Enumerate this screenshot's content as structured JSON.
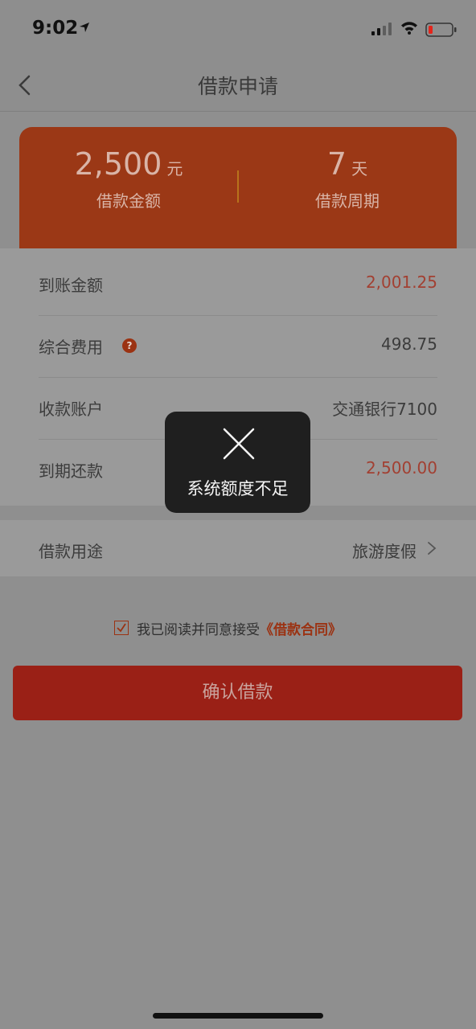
{
  "status_bar": {
    "time": "9:02"
  },
  "nav": {
    "title": "借款申请"
  },
  "summary": {
    "amount": "2,500",
    "amount_unit": "元",
    "amount_label": "借款金额",
    "period": "7",
    "period_unit": "天",
    "period_label": "借款周期"
  },
  "details": {
    "rows": [
      {
        "label": "到账金额",
        "value": "2,001.25"
      },
      {
        "label": "综合费用",
        "value": "498.75",
        "help": "?"
      },
      {
        "label": "收款账户",
        "value": "交通银行7100"
      },
      {
        "label": "到期还款",
        "value": "2,500.00"
      }
    ]
  },
  "purpose": {
    "label": "借款用途",
    "value": "旅游度假"
  },
  "agreement": {
    "text": "我已阅读并同意接受",
    "link": "《借款合同》",
    "checked": true
  },
  "confirm_button": {
    "label": "确认借款"
  },
  "toast": {
    "message": "系统额度不足"
  },
  "colors": {
    "accent": "#9b3216",
    "value_red": "#a24032",
    "button": "#9a2016"
  }
}
